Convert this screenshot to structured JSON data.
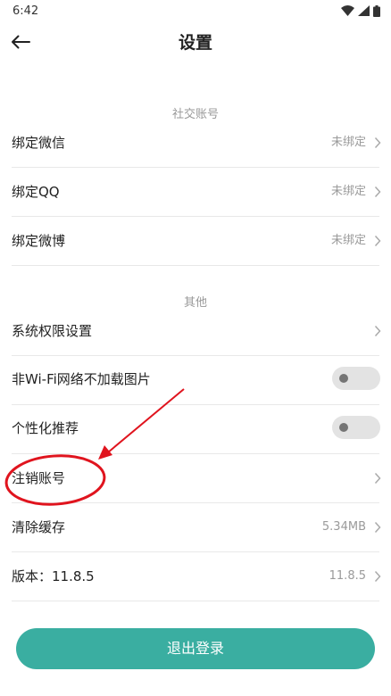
{
  "status_bar": {
    "time": "6:42"
  },
  "header": {
    "title": "设置"
  },
  "sections": {
    "social": {
      "title": "社交账号",
      "items": [
        {
          "label": "绑定微信",
          "value": "未绑定"
        },
        {
          "label": "绑定QQ",
          "value": "未绑定"
        },
        {
          "label": "绑定微博",
          "value": "未绑定"
        }
      ]
    },
    "other": {
      "title": "其他",
      "permission": {
        "label": "系统权限设置"
      },
      "no_wifi_images": {
        "label": "非Wi-Fi网络不加载图片",
        "enabled": false
      },
      "personalized": {
        "label": "个性化推荐",
        "enabled": false
      },
      "cancel_account": {
        "label": "注销账号"
      },
      "clear_cache": {
        "label": "清除缓存",
        "value": "5.34MB"
      },
      "version": {
        "label": "版本：11.8.5",
        "value": "11.8.5"
      }
    }
  },
  "logout": {
    "label": "退出登录"
  },
  "colors": {
    "accent": "#3aaea1",
    "annotation": "#e0141e"
  },
  "icons": [
    "back-arrow-icon",
    "wifi-icon",
    "signal-icon",
    "battery-icon",
    "chevron-right-icon"
  ]
}
